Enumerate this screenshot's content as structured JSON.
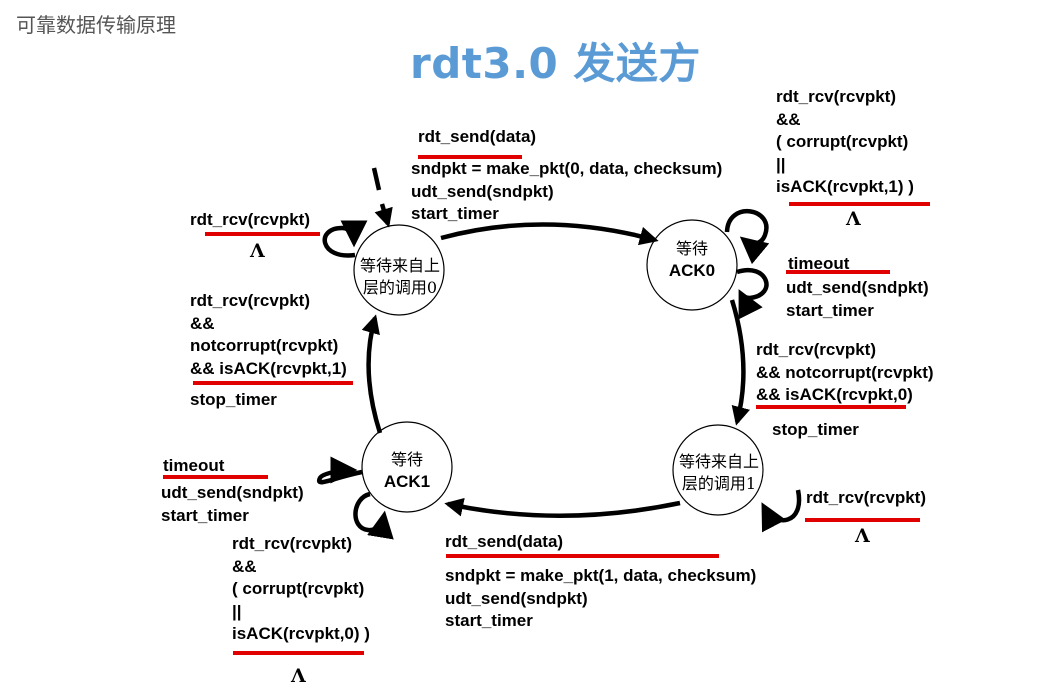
{
  "header": {
    "text": "可靠数据传输原理"
  },
  "title": {
    "text": "rdt3.0 发送方"
  },
  "colors": {
    "title": "#5b9bd5",
    "underline": "#e00000",
    "lines": "#000000"
  },
  "states": {
    "wait_call0": {
      "lines": [
        "等待来自上",
        "层的调用0"
      ]
    },
    "wait_ack0": {
      "lines": [
        "等待",
        "ACK0"
      ]
    },
    "wait_call1": {
      "lines": [
        "等待来自上",
        "层的调用1"
      ]
    },
    "wait_ack1": {
      "lines": [
        "等待",
        "ACK1"
      ]
    }
  },
  "labels": {
    "top_event": "rdt_send(data)",
    "top_actions": [
      "sndpkt = make_pkt(0, data, checksum)",
      "udt_send(sndpkt)",
      "start_timer"
    ],
    "call0_self_event": "rdt_rcv(rcvpkt)",
    "call0_self_action": "Λ",
    "left_event": [
      "rdt_rcv(rcvpkt)",
      "&&",
      "notcorrupt(rcvpkt)",
      "&& isACK(rcvpkt,1)"
    ],
    "left_action": "stop_timer",
    "ack0_self_event": [
      "rdt_rcv(rcvpkt)",
      "&&",
      "( corrupt(rcvpkt)",
      "||",
      "isACK(rcvpkt,1) )"
    ],
    "ack0_self_action": "Λ",
    "ack0_timeout_event": "timeout",
    "ack0_timeout_actions": [
      "udt_send(sndpkt)",
      "start_timer"
    ],
    "right_event": [
      "rdt_rcv(rcvpkt)",
      "&& notcorrupt(rcvpkt)",
      "&& isACK(rcvpkt,0)"
    ],
    "right_action": "stop_timer",
    "call1_self_event": "rdt_rcv(rcvpkt)",
    "call1_self_action": "Λ",
    "bottom_event": "rdt_send(data)",
    "bottom_actions": [
      "sndpkt = make_pkt(1, data, checksum)",
      "udt_send(sndpkt)",
      "start_timer"
    ],
    "ack1_timeout_event": "timeout",
    "ack1_timeout_actions": [
      "udt_send(sndpkt)",
      "start_timer"
    ],
    "ack1_self_event": [
      "rdt_rcv(rcvpkt)",
      "&&",
      "( corrupt(rcvpkt)",
      "||",
      "isACK(rcvpkt,0) )"
    ],
    "ack1_self_action": "Λ"
  }
}
